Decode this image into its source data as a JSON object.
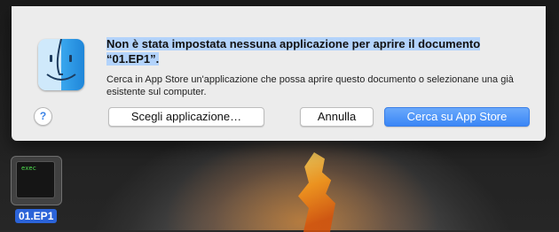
{
  "dialog": {
    "title_line1": "Non è stata impostata nessuna applicazione per aprire il documento",
    "title_line2": "“01.EP1”.",
    "description": "Cerca in App Store un'applicazione che possa aprire questo documento o selezionane una già esistente sul computer.",
    "help_label": "?",
    "buttons": {
      "choose": "Scegli applicazione…",
      "cancel": "Annulla",
      "search_store": "Cerca su App Store"
    },
    "accent_color": "#3a86f6",
    "selection_color": "#b3d3fb"
  },
  "desktop": {
    "file_icon_text": "exec",
    "file_name": "01.EP1"
  }
}
